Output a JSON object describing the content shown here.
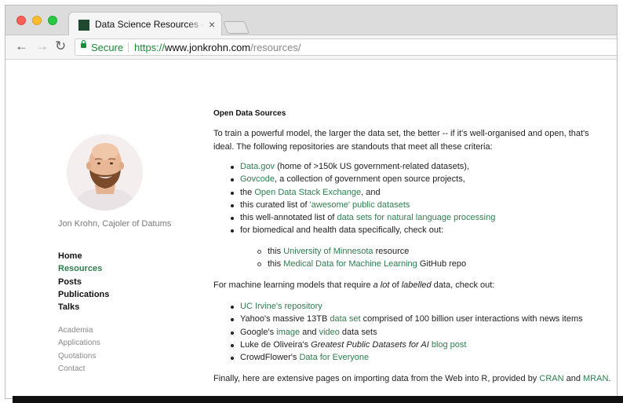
{
  "browser": {
    "tab_title": "Data Science Resources — Jon Krohn",
    "tab_close": "×",
    "nav_back": "←",
    "nav_forward": "→",
    "nav_reload": "↻",
    "secure_label": "Secure",
    "url_scheme": "https://",
    "url_host": "www.jonkrohn.com",
    "url_path": "/resources/"
  },
  "sidebar": {
    "author": "Jon Krohn, Cajoler of Datums",
    "main_nav": [
      "Home",
      "Resources",
      "Posts",
      "Publications",
      "Talks"
    ],
    "active_item": "Resources",
    "sub_nav": [
      "Academia",
      "Applications",
      "Quotations",
      "Contact"
    ]
  },
  "content": {
    "heading": "Open Data Sources",
    "intro": "To train a powerful model, the larger the data set, the better -- if it's well-organised and open, that's ideal. The following repositories are standouts that meet all these criteria:",
    "list1": {
      "i1_link": "Data.gov",
      "i1_text": " (home of >150k US government-related datasets),",
      "i2_link": "Govcode",
      "i2_text": ", a collection of government open source projects,",
      "i3_pre": "the ",
      "i3_link": "Open Data Stack Exchange",
      "i3_post": ", and",
      "i4_pre": "this curated list of ",
      "i4_link": "'awesome' public datasets",
      "i5_pre": "this well-annotated list of ",
      "i5_link": "data sets for natural language processing",
      "i6_text": "for biomedical and health data specifically, check out:"
    },
    "sublist": {
      "s1_pre": "this ",
      "s1_link": "University of Minnesota",
      "s1_post": " resource",
      "s2_pre": "this ",
      "s2_link": "Medical Data for Machine Learning",
      "s2_post": " GitHub repo"
    },
    "ml_intro": {
      "pre": "For machine learning models that require ",
      "em1": "a lot",
      "mid": " of ",
      "em2": "labelled",
      "post": " data, check out:"
    },
    "list2": {
      "i1_link": "UC Irvine's repository",
      "i2_pre": "Yahoo's massive 13TB ",
      "i2_link": "data set",
      "i2_post": " comprised of 100 billion user interactions with news items",
      "i3_pre": "Google's ",
      "i3_link1": "image",
      "i3_mid": " and ",
      "i3_link2": "video",
      "i3_post": " data sets",
      "i4_pre": "Luke de Oliveira's ",
      "i4_em": "Greatest Public Datasets for AI",
      "i4_mid": " ",
      "i4_link": "blog post",
      "i5_pre": "CrowdFlower's ",
      "i5_link": "Data for Everyone"
    },
    "final": {
      "pre": "Finally, here are extensive pages on importing data from the Web into R, provided by ",
      "link1": "CRAN",
      "mid": " and ",
      "link2": "MRAN",
      "post": "."
    }
  }
}
